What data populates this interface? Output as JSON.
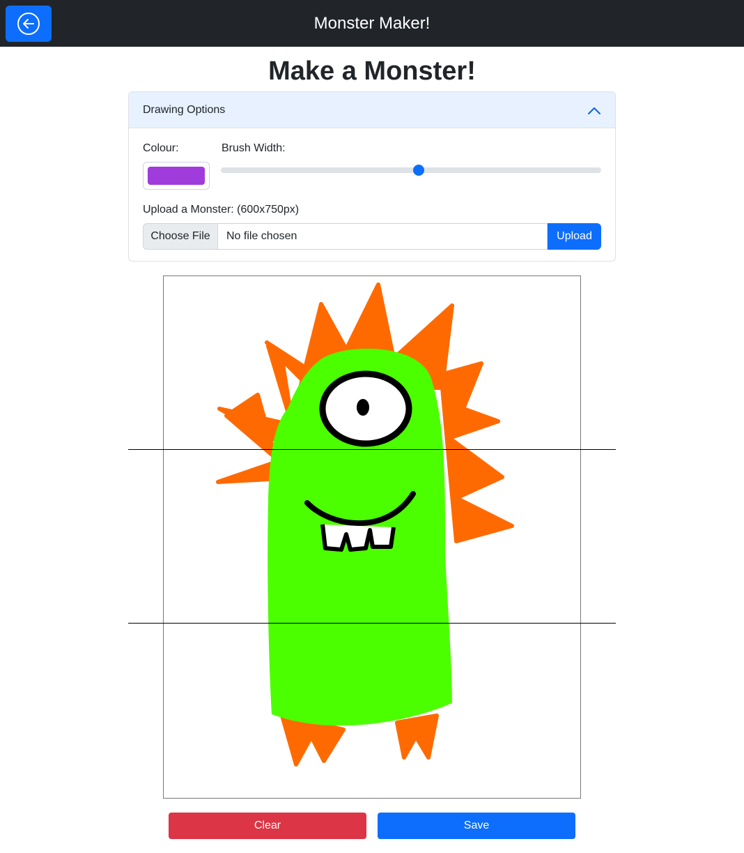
{
  "navbar": {
    "title": "Monster Maker!",
    "back_icon": "arrow-left-circle-icon"
  },
  "page": {
    "heading": "Make a Monster!"
  },
  "drawing_options": {
    "title": "Drawing Options",
    "expanded": true,
    "colour_label": "Colour:",
    "colour_value": "#a03bdc",
    "brush_label": "Brush Width:",
    "brush_value_fraction": 0.52,
    "upload_label": "Upload a Monster: (600x750px)",
    "choose_file_label": "Choose File",
    "file_name_text": "No file chosen",
    "upload_button": "Upload"
  },
  "canvas": {
    "body_colour": "#4cff00",
    "spike_colour": "#ff6a00",
    "outline_colour": "#000000"
  },
  "actions": {
    "clear_label": "Clear",
    "save_label": "Save"
  },
  "colors": {
    "navbar": "#212529",
    "primary": "#0d6efd",
    "danger": "#dc3545"
  }
}
